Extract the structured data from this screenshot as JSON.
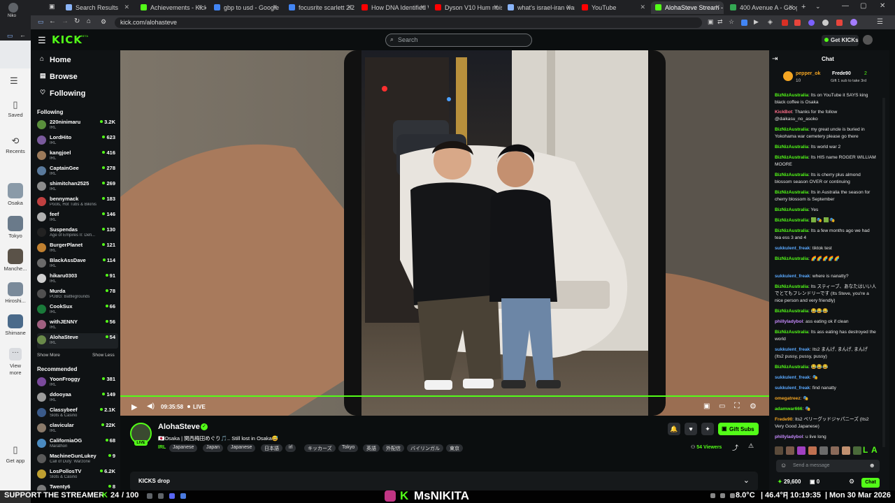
{
  "os_left": {
    "user_label": "Niko",
    "items": [
      {
        "label": "Saved"
      },
      {
        "label": "Recents"
      },
      {
        "label": "Osaka"
      },
      {
        "label": "Tokyo"
      },
      {
        "label": "Manche..."
      },
      {
        "label": "Hiroshi..."
      },
      {
        "label": "Shimane"
      },
      {
        "label": "View more"
      },
      {
        "label": "Get app"
      }
    ]
  },
  "browser": {
    "tabs": [
      {
        "label": "Search Results",
        "color": "#8ab4f8"
      },
      {
        "label": "Achievements - Kick Da",
        "color": "#53fc18"
      },
      {
        "label": "gbp to usd - Google Search",
        "color": "#4285f4"
      },
      {
        "label": "focusrite scarlett 2i2 3rd gen",
        "color": "#4285f4"
      },
      {
        "label": "How DNA Identified Walker",
        "color": "#ff0000"
      },
      {
        "label": "Dyson V10 Hum noise and s",
        "color": "#ff0000"
      },
      {
        "label": "what's israel-iran war about",
        "color": "#8ab4f8"
      },
      {
        "label": "YouTube",
        "color": "#ff0000"
      },
      {
        "label": "AlohaSteve Stream - Watch",
        "color": "#53fc18"
      },
      {
        "label": "400 Avenue A - Google Maps",
        "color": "#34a853"
      }
    ],
    "url": "kick.com/alohasteve"
  },
  "header": {
    "logo": "KICK",
    "logo_badge": "BETA",
    "search_placeholder": "Search",
    "get_kicks": "Get KICKs"
  },
  "sidebar": {
    "nav": [
      {
        "label": "Home"
      },
      {
        "label": "Browse"
      },
      {
        "label": "Following"
      }
    ],
    "following_title": "Following",
    "following": [
      {
        "name": "220ninimaru",
        "cat": "IRL",
        "viewers": "3.2K",
        "color": "#5a8f3c"
      },
      {
        "name": "LordHito",
        "cat": "IRL",
        "viewers": "623",
        "color": "#7a5a9c"
      },
      {
        "name": "kangjoel",
        "cat": "IRL",
        "viewers": "416",
        "color": "#9c7a5a"
      },
      {
        "name": "CaptainGee",
        "cat": "IRL",
        "viewers": "278",
        "color": "#5a7a9c"
      },
      {
        "name": "shimitchan2525",
        "cat": "IRL",
        "viewers": "269",
        "color": "#8c8c8c"
      },
      {
        "name": "bennymack",
        "cat": "Pools, Hot Tubs & Bikinis",
        "viewers": "183",
        "color": "#c04040"
      },
      {
        "name": "feef",
        "cat": "IRL",
        "viewers": "146",
        "color": "#b0b0b0"
      },
      {
        "name": "Suspendas",
        "cat": "Age of Empires II: Defi...",
        "viewers": "130",
        "color": "#222"
      },
      {
        "name": "BurgerPlanet",
        "cat": "IRL",
        "viewers": "121",
        "color": "#c08030"
      },
      {
        "name": "BlackAssDave",
        "cat": "IRL",
        "viewers": "114",
        "color": "#6a6a6a"
      },
      {
        "name": "hikaru0303",
        "cat": "IRL",
        "viewers": "91",
        "color": "#d0d0d0"
      },
      {
        "name": "Murda",
        "cat": "PUBG: Battlegrounds",
        "viewers": "78",
        "color": "#505050"
      },
      {
        "name": "CookSux",
        "cat": "IRL",
        "viewers": "66",
        "color": "#1a7a3a"
      },
      {
        "name": "withJENNY",
        "cat": "IRL",
        "viewers": "56",
        "color": "#a06080"
      },
      {
        "name": "AlohaSteve",
        "cat": "IRL",
        "viewers": "54",
        "color": "#6a8a4a"
      }
    ],
    "show_more": "Show More",
    "show_less": "Show Less",
    "recommended_title": "Recommended",
    "recommended": [
      {
        "name": "YoonFroggy",
        "cat": "IRL",
        "viewers": "381",
        "color": "#7a4a9c"
      },
      {
        "name": "ddooyaa",
        "cat": "IRL",
        "viewers": "149",
        "color": "#9c9c9c"
      },
      {
        "name": "Classybeef",
        "cat": "Slots & Casino",
        "viewers": "2.1K",
        "color": "#3a5a8a"
      },
      {
        "name": "clavicular",
        "cat": "IRL",
        "viewers": "22K",
        "color": "#8a7a6a"
      },
      {
        "name": "CaliforniaOG",
        "cat": "Marathon",
        "viewers": "68",
        "color": "#4a8ac0"
      },
      {
        "name": "MachineGunLukey",
        "cat": "Call of Duty: Warzone",
        "viewers": "9",
        "color": "#5a5a5a"
      },
      {
        "name": "LosPollosTV",
        "cat": "Slots & Casino",
        "viewers": "6.2K",
        "color": "#c0a030"
      },
      {
        "name": "Twenty6",
        "cat": "",
        "viewers": "8",
        "color": "#7a7a7a"
      }
    ]
  },
  "player": {
    "time": "09:35:58",
    "live": "LIVE"
  },
  "stream": {
    "streamer": "AlohaSteve",
    "live_badge": "LIVE",
    "title": "🇯🇵Osaka | 関西梅田めぐり🎵.. Still lost in Osaka😅",
    "category": "IRL",
    "tags": [
      "Japanese",
      "Japan",
      "Japanese",
      "日本語",
      "irl",
      "キッカーズ",
      "Tokyo",
      "英語",
      "外配信",
      "バイリンガル",
      "東京"
    ],
    "viewers_count": "54",
    "viewers_label": "Viewers",
    "gift_subs": "Gift Subs",
    "kicks_drop": "KICKS drop"
  },
  "chat": {
    "title": "Chat",
    "leader1_name": "pepper_ok",
    "leader1_value": "10",
    "leader2_name": "Frede90",
    "leader2_value": "2",
    "leader2_sub": "Gift 1 sub to take 3rd",
    "messages": [
      {
        "user": "BizNizAustralia",
        "uc": "g",
        "text": "Its on YouTube it SAYS king black coffee is Osaka"
      },
      {
        "user": "KickBot",
        "uc": "r",
        "text": "Thanks for the follow @daikasu_no_asoko"
      },
      {
        "user": "BizNizAustralia",
        "uc": "g",
        "text": "my great uncle is buried in Yokohama war cemetery please go there"
      },
      {
        "user": "BizNizAustralia",
        "uc": "g",
        "text": "Its world war 2"
      },
      {
        "user": "BizNizAustralia",
        "uc": "g",
        "text": "Its HIS name ROGER WILLIAM MOORE"
      },
      {
        "user": "BizNizAustralia",
        "uc": "g",
        "text": "Its is cherry plus almond blossom season OVER or continuing"
      },
      {
        "user": "BizNizAustralia",
        "uc": "g",
        "text": "Its in Australia the season for cherry blossom is September"
      },
      {
        "user": "BizNizAustralia",
        "uc": "g",
        "text": "Yes"
      },
      {
        "user": "BizNizAustralia",
        "uc": "g",
        "text": "🟩🎭 🟩🎭"
      },
      {
        "user": "BizNizAustralia",
        "uc": "g",
        "text": "Its a few months ago we had tea ess 3 and 4"
      },
      {
        "user": "sukkulent_freak",
        "uc": "b",
        "text": "tiktok test"
      },
      {
        "user": "BizNizAustralia",
        "uc": "g",
        "text": "🌈🌈🌈🌈🌈"
      },
      {
        "user": "sukkulent_freak",
        "uc": "b",
        "text": "where is nanatty?"
      },
      {
        "user": "BizNizAustralia",
        "uc": "g",
        "text": "Its スティーブ、あなたはいい人でとてもフレンドリーです (Its Steve, you're a nice person and very friendly)"
      },
      {
        "user": "BizNizAustralia",
        "uc": "g",
        "text": "😂😂😂"
      },
      {
        "user": "phillyladybol",
        "uc": "p",
        "text": "ass eating ok if clean"
      },
      {
        "user": "BizNizAustralia",
        "uc": "g",
        "text": "Its ass eating has destroyed the world"
      },
      {
        "user": "sukkulent_freak",
        "uc": "b",
        "text": "Its2 まんげ, まんげ, まんげ (Its2 pussy, pussy, pussy)"
      },
      {
        "user": "BizNizAustralia",
        "uc": "g",
        "text": "😂😂😂"
      },
      {
        "user": "sukkulent_freak",
        "uc": "b",
        "text": "🎭"
      },
      {
        "user": "sukkulent_freak",
        "uc": "b",
        "text": "find nanatty"
      },
      {
        "user": "omegatreez",
        "uc": "o",
        "text": "🎭"
      },
      {
        "user": "adamwar666",
        "uc": "g",
        "text": "🎭"
      },
      {
        "user": "Frede90",
        "uc": "o",
        "text": "Its2 ベリーグッドジャパニーズ (Its2 Very Good Japanese)"
      },
      {
        "user": "phillyladybol",
        "uc": "p",
        "text": "u live long"
      }
    ],
    "input_placeholder": "Send a message",
    "points": "29,600",
    "count": "0",
    "send_label": "Chat"
  },
  "overlay": {
    "left_text": "SUPPORT THE STREAMER",
    "sub_count": "24",
    "goal": "100",
    "center_name": "MsNIKITA",
    "weather": "8.0°C",
    "weather_f": "46.4°F",
    "clock": "10:19:35",
    "date": "Mon 30 Mar 2026"
  }
}
